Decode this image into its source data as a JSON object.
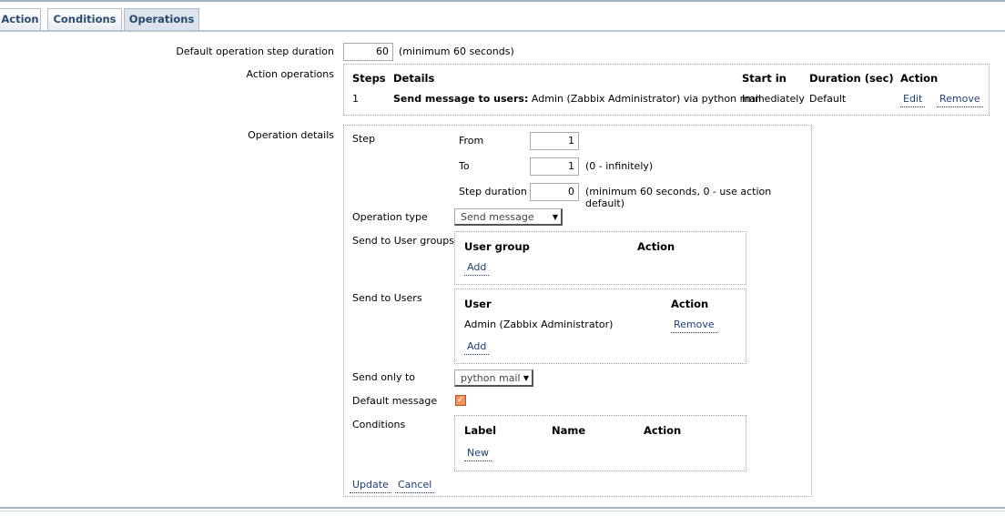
{
  "tabs": [
    {
      "label": "Action"
    },
    {
      "label": "Conditions"
    },
    {
      "label": "Operations"
    }
  ],
  "default_step": {
    "label": "Default operation step duration",
    "value": "60",
    "hint": "(minimum 60 seconds)"
  },
  "action_operations": {
    "label": "Action operations",
    "headers": {
      "steps": "Steps",
      "details": "Details",
      "start_in": "Start in",
      "duration": "Duration (sec)",
      "action": "Action"
    },
    "rows": [
      {
        "step": "1",
        "details_bold": "Send message to users:",
        "details_rest": "Admin (Zabbix Administrator) via python mail",
        "start_in": "Immediately",
        "duration": "Default",
        "edit": "Edit",
        "remove": "Remove"
      }
    ]
  },
  "operation_details": {
    "label": "Operation details",
    "step_label": "Step",
    "from_label": "From",
    "from_value": "1",
    "to_label": "To",
    "to_value": "1",
    "to_hint": "(0 - infinitely)",
    "step_duration_label": "Step duration",
    "step_duration_value": "0",
    "step_duration_hint": "(minimum 60 seconds, 0 - use action default)",
    "operation_type_label": "Operation type",
    "operation_type_value": "Send message",
    "user_groups_label": "Send to User groups",
    "user_groups_headers": {
      "group": "User group",
      "action": "Action"
    },
    "user_groups_add": "Add",
    "users_label": "Send to Users",
    "users_headers": {
      "user": "User",
      "action": "Action"
    },
    "users_rows": [
      {
        "name": "Admin (Zabbix Administrator)",
        "remove": "Remove"
      }
    ],
    "users_add": "Add",
    "send_only_label": "Send only to",
    "send_only_value": "python mail",
    "default_message_label": "Default message",
    "default_message_checked": true,
    "conditions_label": "Conditions",
    "conditions_headers": {
      "label": "Label",
      "name": "Name",
      "action": "Action"
    },
    "conditions_new": "New",
    "update": "Update",
    "cancel": "Cancel"
  },
  "colors": {
    "link": "#1f3e7a",
    "tab_text": "#2a4c72",
    "checkbox": "#f0945c"
  }
}
